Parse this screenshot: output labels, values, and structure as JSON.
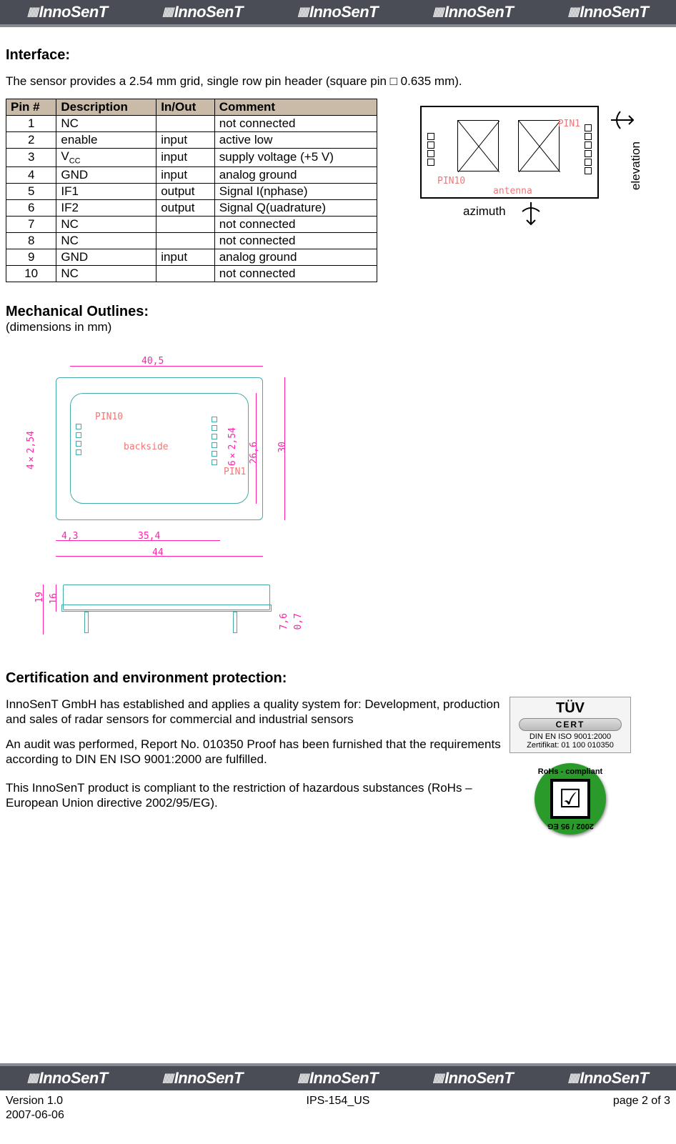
{
  "brand": "InnoSenT",
  "sections": {
    "interface": {
      "title": "Interface:",
      "intro": "The sensor provides a 2.54 mm grid, single row pin header (square pin □ 0.635 mm).",
      "table_headers": {
        "pin": "Pin #",
        "desc": "Description",
        "io": "In/Out",
        "comment": "Comment"
      },
      "rows": [
        {
          "pin": "1",
          "desc": "NC",
          "io": "",
          "comment": "not connected"
        },
        {
          "pin": "2",
          "desc": "enable",
          "io": "input",
          "comment": "active low"
        },
        {
          "pin": "3",
          "desc": "V",
          "desc_sub": "CC",
          "io": "input",
          "comment": "supply voltage (+5 V)"
        },
        {
          "pin": "4",
          "desc": "GND",
          "io": "input",
          "comment": "analog ground"
        },
        {
          "pin": "5",
          "desc": "IF1",
          "io": "output",
          "comment": "Signal I(nphase)"
        },
        {
          "pin": "6",
          "desc": "IF2",
          "io": "output",
          "comment": "Signal Q(uadrature)"
        },
        {
          "pin": "7",
          "desc": "NC",
          "io": "",
          "comment": "not connected"
        },
        {
          "pin": "8",
          "desc": "NC",
          "io": "",
          "comment": "not connected"
        },
        {
          "pin": "9",
          "desc": "GND",
          "io": "input",
          "comment": "analog ground"
        },
        {
          "pin": "10",
          "desc": "NC",
          "io": "",
          "comment": "not connected"
        }
      ],
      "antenna_labels": {
        "pin1": "PIN1",
        "pin10": "PIN10",
        "antenna": "antenna",
        "azimuth": "azimuth",
        "elevation": "elevation"
      }
    },
    "mechanical": {
      "title": "Mechanical Outlines:",
      "subtitle": "(dimensions in mm)",
      "labels": {
        "pin1": "PIN1",
        "pin10": "PIN10",
        "backside": "backside"
      },
      "dims": {
        "w_inner": "40,5",
        "offset_l": "4,3",
        "w_mid": "35,4",
        "w_full": "44",
        "h_full": "30",
        "h_inner": "26,6",
        "pitch4": "4×2,54",
        "pitch6": "6×2,54",
        "side_h1": "19",
        "side_h2": "16",
        "side_p1": "7,6",
        "side_p2": "0,7"
      }
    },
    "certification": {
      "title": "Certification and environment protection:",
      "p1": "InnoSenT GmbH has established and applies a quality system for: Development, production and sales of radar sensors for commercial and industrial sensors",
      "p2": "An audit was performed, Report No. 010350 Proof has been furnished that the requirements according to DIN EN ISO 9001:2000 are fulfilled.",
      "p3": "This InnoSenT product is compliant to the restriction of hazardous substances (RoHs – European Union directive 2002/95/EG).",
      "tuv": {
        "brand": "TÜV",
        "cert": "CERT",
        "line1": "DIN EN ISO 9001:2000",
        "line2": "Zertifikat: 01 100 010350"
      },
      "rohs": {
        "top": "RoHs - compliant",
        "bottom": "2002 / 95 EG"
      }
    }
  },
  "footer": {
    "version": "Version 1.0",
    "doc": "IPS-154_US",
    "page": "page 2 of 3",
    "date": "2007-06-06"
  }
}
